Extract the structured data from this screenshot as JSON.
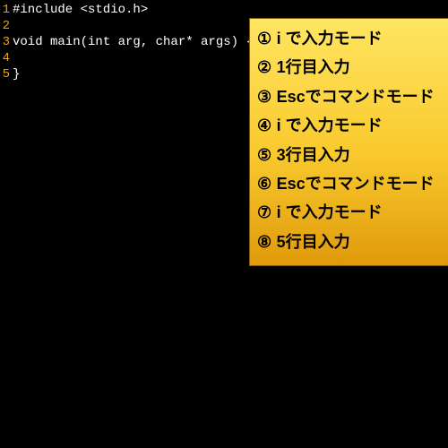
{
  "editor": {
    "lines": [
      {
        "n": "1",
        "text": "#include <stdio.h>"
      },
      {
        "n": "2",
        "text": ""
      },
      {
        "n": "3",
        "text": "void main(int arg, char* args) {"
      },
      {
        "n": "4",
        "text": ""
      },
      {
        "n": "5",
        "text": "}"
      }
    ]
  },
  "overlay": {
    "items": [
      {
        "num": "①",
        "text": "i で入力モード"
      },
      {
        "num": "②",
        "text": "1行目入力"
      },
      {
        "num": "③",
        "text": "Escでコマンドモード"
      },
      {
        "num": "④",
        "text": "i で入力モード"
      },
      {
        "num": "⑤",
        "text": "3行目入力"
      },
      {
        "num": "⑥",
        "text": "Escでコマンドモード"
      },
      {
        "num": "⑦",
        "text": "i で入力モード"
      },
      {
        "num": "⑧",
        "text": "5行目入力"
      }
    ]
  }
}
